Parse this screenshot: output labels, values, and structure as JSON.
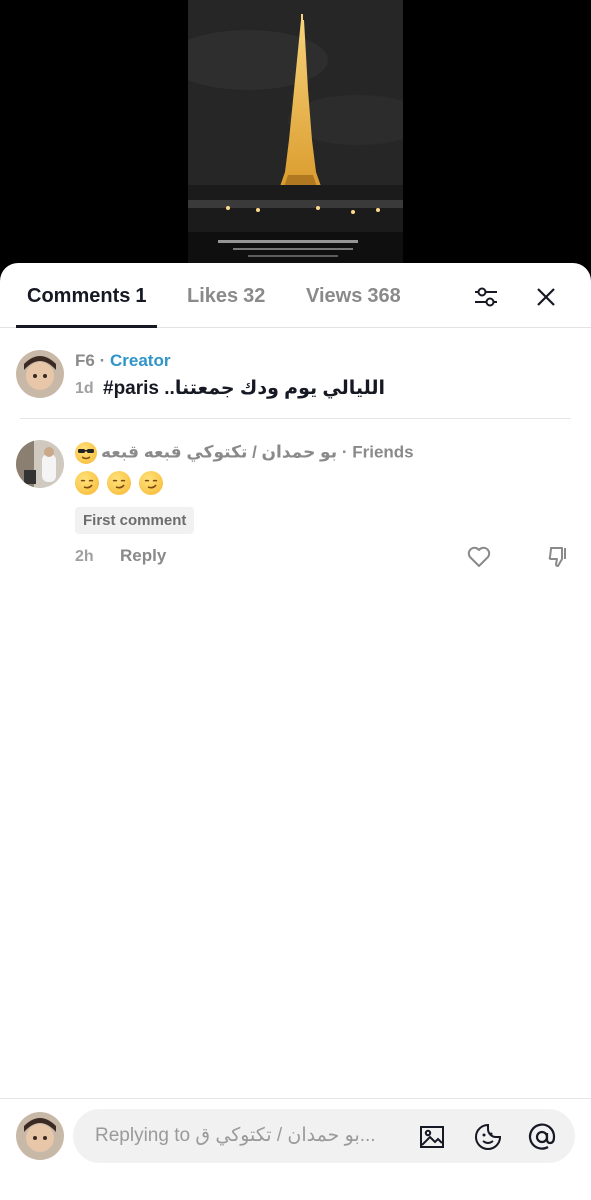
{
  "tabs": [
    {
      "label": "Comments",
      "count": "1"
    },
    {
      "label": "Likes",
      "count": "32"
    },
    {
      "label": "Views",
      "count": "368"
    }
  ],
  "comments": [
    {
      "username": "F6",
      "separator": "·",
      "role": "Creator",
      "time": "1d",
      "text_tag": "#paris",
      "text_arabic": "الليالي يوم ودك جمعتنا.."
    },
    {
      "username": "بو حمدان / تكتوكي قبعه قبعه",
      "separator": "·",
      "role": "Friends",
      "badge": "First comment",
      "time": "2h",
      "reply_label": "Reply"
    }
  ],
  "composer": {
    "placeholder": "Replying to بو حمدان / تكتوكي ق..."
  },
  "icons": [
    "filter-icon",
    "close-icon",
    "heart-icon",
    "dislike-icon",
    "image-icon",
    "emoji-icon",
    "mention-icon"
  ],
  "colors": {
    "creator": "#2f95c7",
    "text": "#161823",
    "muted": "#8a8a8a"
  }
}
